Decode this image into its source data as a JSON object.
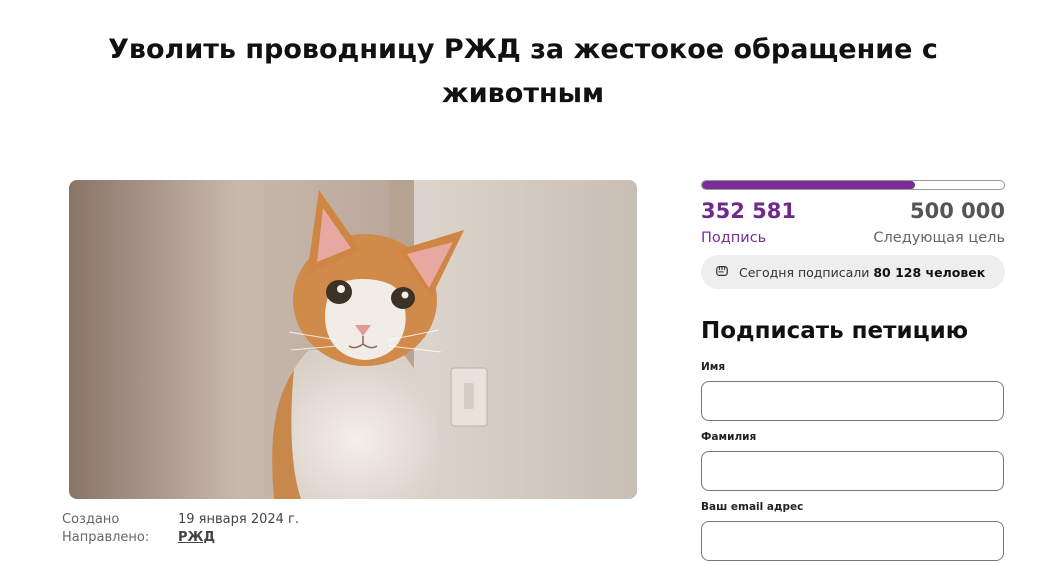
{
  "petition": {
    "title": "Уволить проводницу РЖД за жестокое обращение с животным",
    "created_label": "Создано",
    "created_value": "19 января 2024 г.",
    "directed_label": "Направлено:",
    "directed_value": "РЖД"
  },
  "signatures": {
    "count": "352 581",
    "count_label": "Подпись",
    "goal": "500 000",
    "goal_label": "Следующая цель",
    "progress_fraction": 0.705,
    "today_prefix": "Сегодня подписали",
    "today_count": "80 128 человек"
  },
  "form": {
    "title": "Подписать петицию",
    "first_name_label": "Имя",
    "first_name_value": "",
    "last_name_label": "Фамилия",
    "last_name_value": "",
    "email_label": "Ваш email адрес",
    "email_value": ""
  },
  "colors": {
    "accent": "#7b2d97",
    "link": "#1b6ec2"
  },
  "icons": {
    "today": "fist-icon"
  }
}
